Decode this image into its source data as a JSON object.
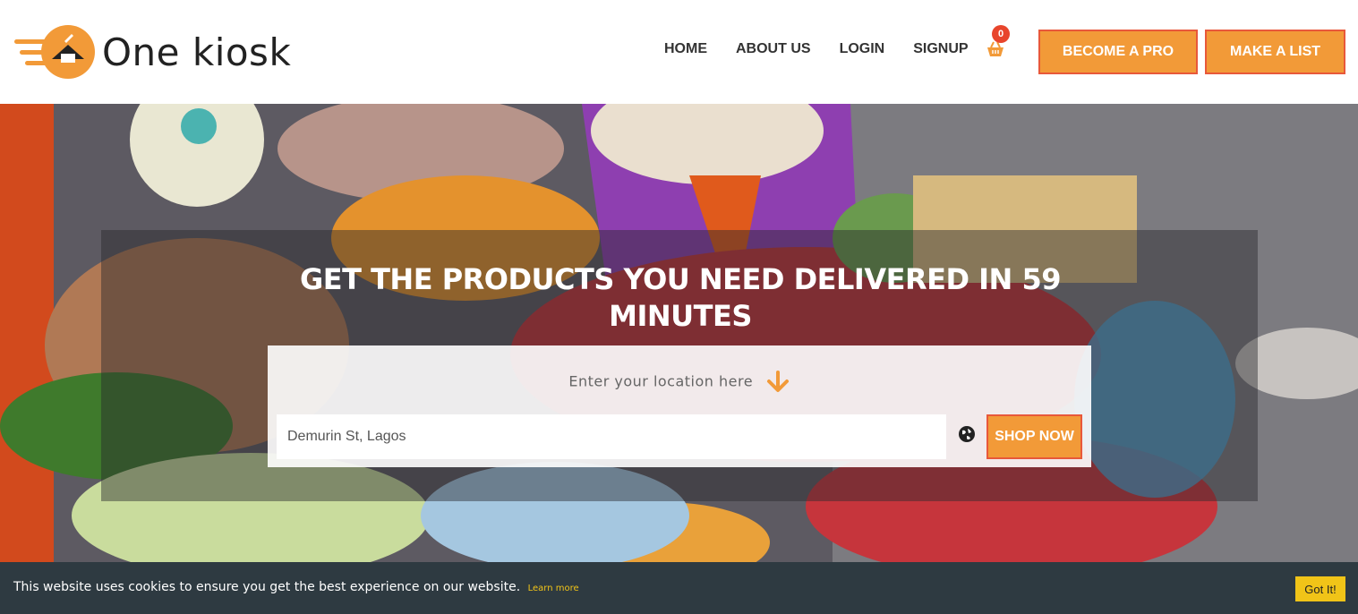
{
  "brand": {
    "name": "One kiosk",
    "accent": "#f29a38",
    "accent_border": "#e8583a"
  },
  "nav": {
    "items": [
      {
        "label": "HOME"
      },
      {
        "label": "ABOUT US"
      },
      {
        "label": "LOGIN"
      },
      {
        "label": "SIGNUP"
      }
    ],
    "cart_count": "0",
    "cart_icon": "basket-icon"
  },
  "header_buttons": {
    "become_pro": "BECOME A PRO",
    "make_list": "MAKE A LIST"
  },
  "hero": {
    "title": "GET THE PRODUCTS YOU NEED DELIVERED IN 59 MINUTES",
    "hint": "Enter your location here",
    "location_value": "Demurin St, Lagos",
    "shop_button": "SHOP NOW"
  },
  "cookie": {
    "text": "This website uses cookies to ensure you get the best experience on our website.",
    "link": "Learn more",
    "button": "Got It!"
  }
}
